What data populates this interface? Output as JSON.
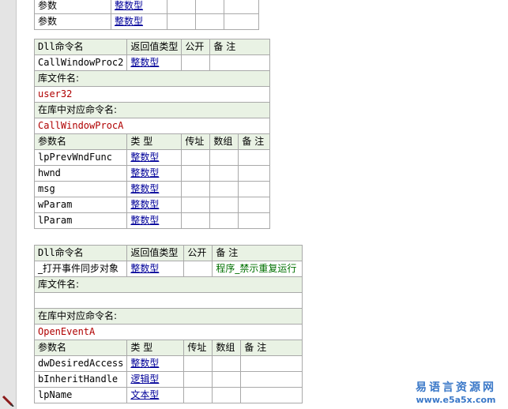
{
  "top_table": {
    "rows": [
      {
        "name": "参数",
        "type": "整数型"
      },
      {
        "name": "参数",
        "type": "整数型"
      }
    ]
  },
  "dll1": {
    "headers": {
      "name": "Dll命令名",
      "ret": "返回值类型",
      "public": "公开",
      "note": "备 注"
    },
    "command": {
      "name": "CallWindowProc2",
      "ret": "整数型",
      "public": "",
      "note": ""
    },
    "lib_label": "库文件名:",
    "lib_value": "user32",
    "orig_label": "在库中对应命令名:",
    "orig_value": "CallWindowProcA",
    "param_headers": {
      "name": "参数名",
      "type": "类 型",
      "byref": "传址",
      "array": "数组",
      "note": "备 注"
    },
    "params": [
      {
        "name": "lpPrevWndFunc",
        "type": "整数型"
      },
      {
        "name": "hwnd",
        "type": "整数型"
      },
      {
        "name": "msg",
        "type": "整数型"
      },
      {
        "name": "wParam",
        "type": "整数型"
      },
      {
        "name": "lParam",
        "type": "整数型"
      }
    ]
  },
  "dll2": {
    "headers": {
      "name": "Dll命令名",
      "ret": "返回值类型",
      "public": "公开",
      "note": "备 注"
    },
    "command": {
      "name": "_打开事件同步对象",
      "ret": "整数型",
      "public": "",
      "note": "程序_禁示重复运行"
    },
    "lib_label": "库文件名:",
    "lib_value": "",
    "orig_label": "在库中对应命令名:",
    "orig_value": "OpenEventA",
    "param_headers": {
      "name": "参数名",
      "type": "类 型",
      "byref": "传址",
      "array": "数组",
      "note": "备 注"
    },
    "params": [
      {
        "name": "dwDesiredAccess",
        "type": "整数型"
      },
      {
        "name": "bInheritHandle",
        "type": "逻辑型"
      },
      {
        "name": "lpName",
        "type": "文本型"
      }
    ]
  },
  "watermark": {
    "title": "易语言资源网",
    "url": "www.e5a5x.com"
  },
  "colors": {
    "header_bg": "#e9f2e4",
    "link": "#000099",
    "lib_text": "#b00000",
    "note_text": "#007000",
    "brand": "#3a78c8"
  }
}
